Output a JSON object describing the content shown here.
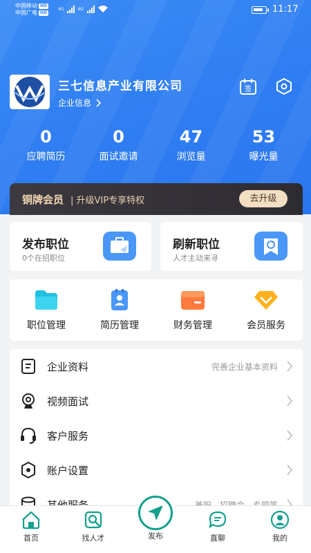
{
  "status_bar": {
    "carrier1": "中国移动",
    "carrier2": "中国广电",
    "hd": "HD",
    "network": "4G",
    "time": "11:17"
  },
  "company": {
    "name": "三七信息产业有限公司",
    "info_link": "企业信息"
  },
  "header_icons": [
    "sign-in-icon",
    "settings-icon"
  ],
  "sign_label": "签",
  "stats": [
    {
      "value": "0",
      "label": "应聘简历"
    },
    {
      "value": "0",
      "label": "面试邀请"
    },
    {
      "value": "47",
      "label": "浏览量"
    },
    {
      "value": "53",
      "label": "曝光量"
    }
  ],
  "vip": {
    "title": "铜牌会员",
    "subtitle": "| 升级VIP专享特权",
    "button": "去升级"
  },
  "post_cards": [
    {
      "title": "发布职位",
      "subtitle": "0个在招职位",
      "icon": "briefcase-icon"
    },
    {
      "title": "刷新职位",
      "subtitle": "人才主动来寻",
      "icon": "refresh-icon"
    }
  ],
  "quick_grid": [
    {
      "label": "职位管理",
      "icon": "folder-icon"
    },
    {
      "label": "简历管理",
      "icon": "resume-icon"
    },
    {
      "label": "财务管理",
      "icon": "wallet-icon"
    },
    {
      "label": "会员服务",
      "icon": "diamond-icon"
    }
  ],
  "menu": [
    {
      "label": "企业资料",
      "hint": "完善企业基本资料",
      "icon": "document-icon"
    },
    {
      "label": "视频面试",
      "hint": "",
      "icon": "camera-icon"
    },
    {
      "label": "客户服务",
      "hint": "",
      "icon": "headset-icon"
    },
    {
      "label": "账户设置",
      "hint": "",
      "icon": "hexagon-settings-icon"
    },
    {
      "label": "其他服务",
      "hint": "兼职、招聘会、专题等",
      "icon": "database-icon"
    }
  ],
  "tabs": [
    {
      "label": "首页",
      "icon": "home-icon"
    },
    {
      "label": "找人才",
      "icon": "search-talent-icon"
    },
    {
      "label": "发布",
      "icon": "send-icon"
    },
    {
      "label": "直聊",
      "icon": "chat-icon"
    },
    {
      "label": "我的",
      "icon": "profile-icon"
    }
  ],
  "colors": {
    "primary": "#2f7df2",
    "accent_green": "#13a08c",
    "vip_dark": "#353338",
    "vip_gold": "#f3dec2"
  }
}
